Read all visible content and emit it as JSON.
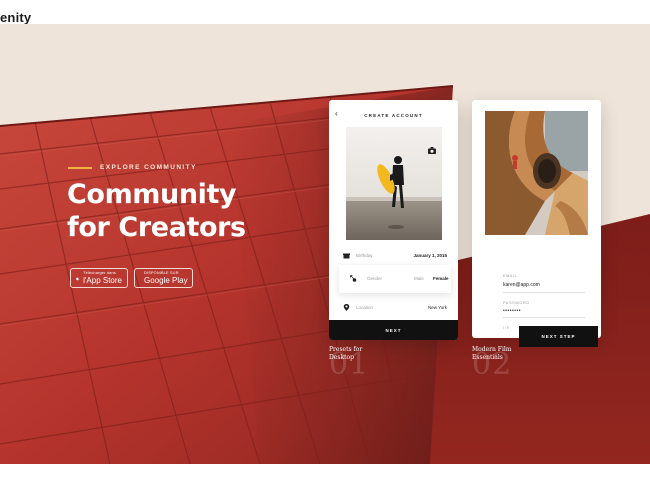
{
  "brand": {
    "logo_text": "enity"
  },
  "hero": {
    "eyebrow": "EXPLORE COMMUNITY",
    "headline_line1": "Community",
    "headline_line2": "for Creators",
    "appstore": {
      "small": "Télécharger dans",
      "big": "l'App Store",
      "icon": "apple-icon"
    },
    "googleplay": {
      "small": "DISPONIBLE SUR",
      "big": "Google Play",
      "icon": "play-icon"
    }
  },
  "create_account": {
    "back_icon": "chevron-left-icon",
    "title": "CREATE ACCOUNT",
    "camera_icon": "camera-icon",
    "birthday_label": "Birthday",
    "birthday_value": "January 1, 2015",
    "gender_label": "Gender",
    "gender_male": "Male",
    "gender_female": "Female",
    "location_label": "Location",
    "location_value": "New York",
    "next_label": "NEXT"
  },
  "login": {
    "email_label": "EMAIL",
    "email_value": "karen@app.com",
    "password_label": "PASSWORD",
    "password_value": "••••••••",
    "small_text": "I / E",
    "next_step_label": "NEXT STEP"
  },
  "items": [
    {
      "caption": "Presets for Desktop",
      "number": "01"
    },
    {
      "caption": "Modern Film Essentials",
      "number": "02"
    }
  ],
  "colors": {
    "hero_bg": "#efe4d9",
    "roof_red": "#b3322c",
    "accent_gold": "#f2b544",
    "dark": "#111111"
  }
}
